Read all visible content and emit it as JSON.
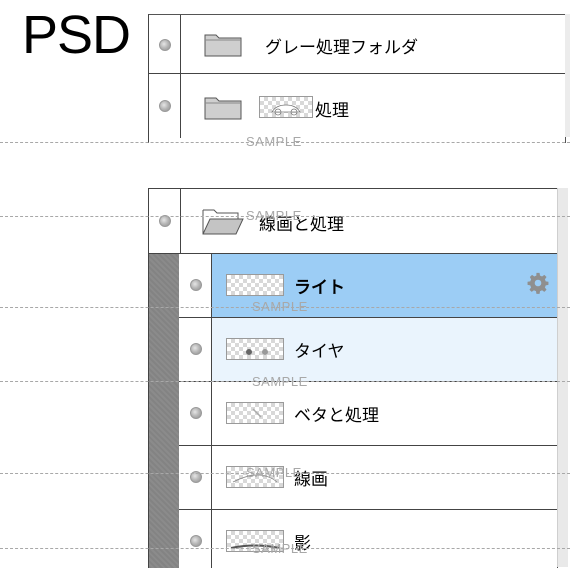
{
  "corner_label": "PSD",
  "top_panel": {
    "rows": [
      {
        "label": "グレー処理フォルダ",
        "icon": "folder-closed"
      },
      {
        "label": "処理",
        "icon": "folder-closed",
        "has_thumbnail": true
      }
    ]
  },
  "group": {
    "label": "線画と処理",
    "icon": "folder-open",
    "layers": [
      {
        "label": "ライト",
        "state": "selected",
        "settings_icon": "gear-icon"
      },
      {
        "label": "タイヤ",
        "state": "hover"
      },
      {
        "label": "ベタと処理",
        "state": "normal"
      },
      {
        "label": "線画",
        "state": "normal"
      },
      {
        "label": "影",
        "state": "normal"
      }
    ]
  },
  "watermark": "SAMPLE",
  "colors": {
    "selected_row": "#9ccdf5",
    "hover_row": "#eaf4fd",
    "group_strip": "#8b8b8b",
    "border": "#444444",
    "watermark": "#a8a8a8"
  }
}
